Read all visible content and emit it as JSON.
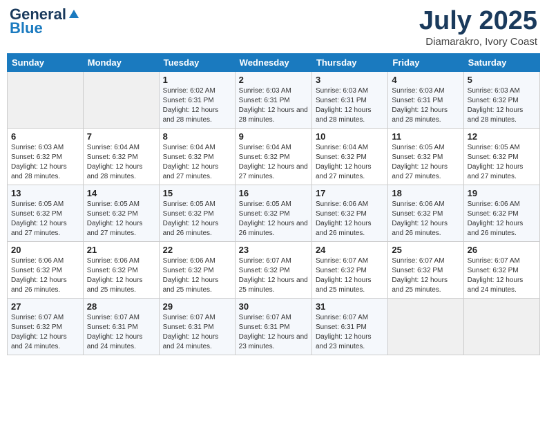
{
  "header": {
    "logo_general": "General",
    "logo_blue": "Blue",
    "month_title": "July 2025",
    "location": "Diamarakro, Ivory Coast"
  },
  "weekdays": [
    "Sunday",
    "Monday",
    "Tuesday",
    "Wednesday",
    "Thursday",
    "Friday",
    "Saturday"
  ],
  "weeks": [
    [
      {
        "day": "",
        "sunrise": "",
        "sunset": "",
        "daylight": ""
      },
      {
        "day": "",
        "sunrise": "",
        "sunset": "",
        "daylight": ""
      },
      {
        "day": "1",
        "sunrise": "Sunrise: 6:02 AM",
        "sunset": "Sunset: 6:31 PM",
        "daylight": "Daylight: 12 hours and 28 minutes."
      },
      {
        "day": "2",
        "sunrise": "Sunrise: 6:03 AM",
        "sunset": "Sunset: 6:31 PM",
        "daylight": "Daylight: 12 hours and 28 minutes."
      },
      {
        "day": "3",
        "sunrise": "Sunrise: 6:03 AM",
        "sunset": "Sunset: 6:31 PM",
        "daylight": "Daylight: 12 hours and 28 minutes."
      },
      {
        "day": "4",
        "sunrise": "Sunrise: 6:03 AM",
        "sunset": "Sunset: 6:31 PM",
        "daylight": "Daylight: 12 hours and 28 minutes."
      },
      {
        "day": "5",
        "sunrise": "Sunrise: 6:03 AM",
        "sunset": "Sunset: 6:32 PM",
        "daylight": "Daylight: 12 hours and 28 minutes."
      }
    ],
    [
      {
        "day": "6",
        "sunrise": "Sunrise: 6:03 AM",
        "sunset": "Sunset: 6:32 PM",
        "daylight": "Daylight: 12 hours and 28 minutes."
      },
      {
        "day": "7",
        "sunrise": "Sunrise: 6:04 AM",
        "sunset": "Sunset: 6:32 PM",
        "daylight": "Daylight: 12 hours and 28 minutes."
      },
      {
        "day": "8",
        "sunrise": "Sunrise: 6:04 AM",
        "sunset": "Sunset: 6:32 PM",
        "daylight": "Daylight: 12 hours and 27 minutes."
      },
      {
        "day": "9",
        "sunrise": "Sunrise: 6:04 AM",
        "sunset": "Sunset: 6:32 PM",
        "daylight": "Daylight: 12 hours and 27 minutes."
      },
      {
        "day": "10",
        "sunrise": "Sunrise: 6:04 AM",
        "sunset": "Sunset: 6:32 PM",
        "daylight": "Daylight: 12 hours and 27 minutes."
      },
      {
        "day": "11",
        "sunrise": "Sunrise: 6:05 AM",
        "sunset": "Sunset: 6:32 PM",
        "daylight": "Daylight: 12 hours and 27 minutes."
      },
      {
        "day": "12",
        "sunrise": "Sunrise: 6:05 AM",
        "sunset": "Sunset: 6:32 PM",
        "daylight": "Daylight: 12 hours and 27 minutes."
      }
    ],
    [
      {
        "day": "13",
        "sunrise": "Sunrise: 6:05 AM",
        "sunset": "Sunset: 6:32 PM",
        "daylight": "Daylight: 12 hours and 27 minutes."
      },
      {
        "day": "14",
        "sunrise": "Sunrise: 6:05 AM",
        "sunset": "Sunset: 6:32 PM",
        "daylight": "Daylight: 12 hours and 27 minutes."
      },
      {
        "day": "15",
        "sunrise": "Sunrise: 6:05 AM",
        "sunset": "Sunset: 6:32 PM",
        "daylight": "Daylight: 12 hours and 26 minutes."
      },
      {
        "day": "16",
        "sunrise": "Sunrise: 6:05 AM",
        "sunset": "Sunset: 6:32 PM",
        "daylight": "Daylight: 12 hours and 26 minutes."
      },
      {
        "day": "17",
        "sunrise": "Sunrise: 6:06 AM",
        "sunset": "Sunset: 6:32 PM",
        "daylight": "Daylight: 12 hours and 26 minutes."
      },
      {
        "day": "18",
        "sunrise": "Sunrise: 6:06 AM",
        "sunset": "Sunset: 6:32 PM",
        "daylight": "Daylight: 12 hours and 26 minutes."
      },
      {
        "day": "19",
        "sunrise": "Sunrise: 6:06 AM",
        "sunset": "Sunset: 6:32 PM",
        "daylight": "Daylight: 12 hours and 26 minutes."
      }
    ],
    [
      {
        "day": "20",
        "sunrise": "Sunrise: 6:06 AM",
        "sunset": "Sunset: 6:32 PM",
        "daylight": "Daylight: 12 hours and 26 minutes."
      },
      {
        "day": "21",
        "sunrise": "Sunrise: 6:06 AM",
        "sunset": "Sunset: 6:32 PM",
        "daylight": "Daylight: 12 hours and 25 minutes."
      },
      {
        "day": "22",
        "sunrise": "Sunrise: 6:06 AM",
        "sunset": "Sunset: 6:32 PM",
        "daylight": "Daylight: 12 hours and 25 minutes."
      },
      {
        "day": "23",
        "sunrise": "Sunrise: 6:07 AM",
        "sunset": "Sunset: 6:32 PM",
        "daylight": "Daylight: 12 hours and 25 minutes."
      },
      {
        "day": "24",
        "sunrise": "Sunrise: 6:07 AM",
        "sunset": "Sunset: 6:32 PM",
        "daylight": "Daylight: 12 hours and 25 minutes."
      },
      {
        "day": "25",
        "sunrise": "Sunrise: 6:07 AM",
        "sunset": "Sunset: 6:32 PM",
        "daylight": "Daylight: 12 hours and 25 minutes."
      },
      {
        "day": "26",
        "sunrise": "Sunrise: 6:07 AM",
        "sunset": "Sunset: 6:32 PM",
        "daylight": "Daylight: 12 hours and 24 minutes."
      }
    ],
    [
      {
        "day": "27",
        "sunrise": "Sunrise: 6:07 AM",
        "sunset": "Sunset: 6:32 PM",
        "daylight": "Daylight: 12 hours and 24 minutes."
      },
      {
        "day": "28",
        "sunrise": "Sunrise: 6:07 AM",
        "sunset": "Sunset: 6:31 PM",
        "daylight": "Daylight: 12 hours and 24 minutes."
      },
      {
        "day": "29",
        "sunrise": "Sunrise: 6:07 AM",
        "sunset": "Sunset: 6:31 PM",
        "daylight": "Daylight: 12 hours and 24 minutes."
      },
      {
        "day": "30",
        "sunrise": "Sunrise: 6:07 AM",
        "sunset": "Sunset: 6:31 PM",
        "daylight": "Daylight: 12 hours and 23 minutes."
      },
      {
        "day": "31",
        "sunrise": "Sunrise: 6:07 AM",
        "sunset": "Sunset: 6:31 PM",
        "daylight": "Daylight: 12 hours and 23 minutes."
      },
      {
        "day": "",
        "sunrise": "",
        "sunset": "",
        "daylight": ""
      },
      {
        "day": "",
        "sunrise": "",
        "sunset": "",
        "daylight": ""
      }
    ]
  ]
}
